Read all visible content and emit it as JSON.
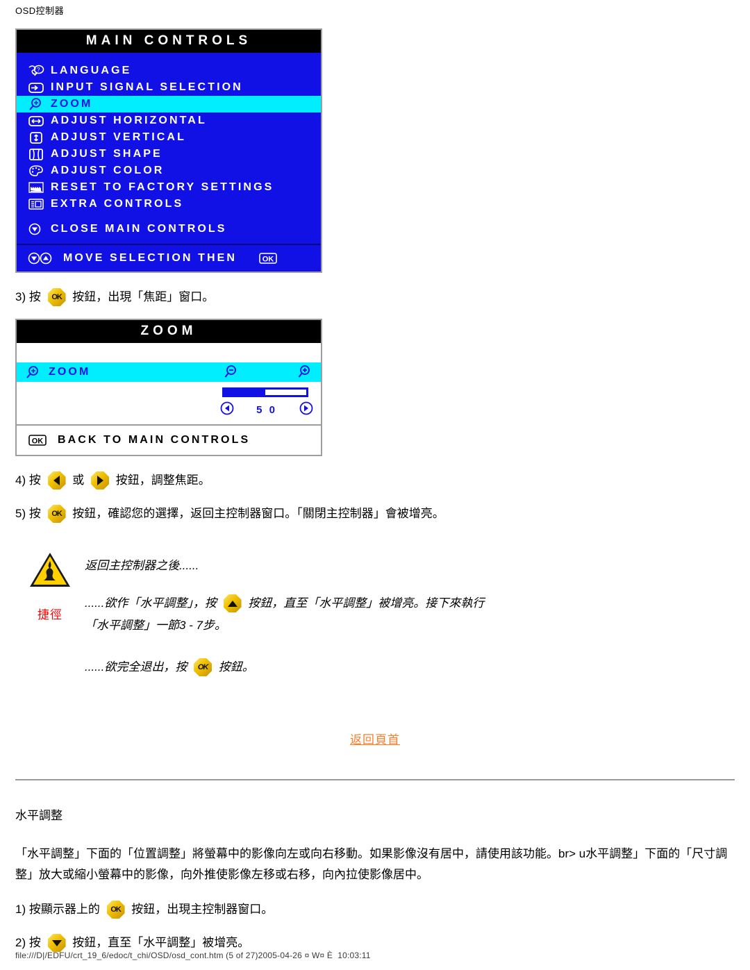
{
  "header": {
    "label": "OSD控制器"
  },
  "main_controls": {
    "title": "MAIN CONTROLS",
    "items": [
      {
        "icon": "language-icon",
        "label": "LANGUAGE",
        "highlighted": false
      },
      {
        "icon": "input-signal-icon",
        "label": "INPUT SIGNAL SELECTION",
        "highlighted": false
      },
      {
        "icon": "zoom-icon",
        "label": "ZOOM",
        "highlighted": true
      },
      {
        "icon": "adjust-horizontal-icon",
        "label": "ADJUST HORIZONTAL",
        "highlighted": false
      },
      {
        "icon": "adjust-vertical-icon",
        "label": "ADJUST VERTICAL",
        "highlighted": false
      },
      {
        "icon": "adjust-shape-icon",
        "label": "ADJUST SHAPE",
        "highlighted": false
      },
      {
        "icon": "adjust-color-icon",
        "label": "ADJUST COLOR",
        "highlighted": false
      },
      {
        "icon": "reset-factory-icon",
        "label": "RESET TO FACTORY SETTINGS",
        "highlighted": false
      },
      {
        "icon": "extra-controls-icon",
        "label": "EXTRA CONTROLS",
        "highlighted": false
      }
    ],
    "close_item": {
      "icon": "down-arrow-icon",
      "label": "CLOSE MAIN CONTROLS"
    },
    "footer": {
      "label": "MOVE SELECTION THEN",
      "ok_icon": "ok-icon"
    }
  },
  "step3": {
    "prefix": "3) 按 ",
    "button": "ok-button",
    "suffix": " 按鈕，出現「焦距」窗口。"
  },
  "zoom_panel": {
    "title": "ZOOM",
    "row_label": "ZOOM",
    "minus_icon": "zoom-out-icon",
    "plus_icon": "zoom-in-icon",
    "value": "5 0",
    "slider_percent": 50,
    "footer_label": "BACK TO MAIN CONTROLS",
    "footer_icon": "ok-icon"
  },
  "step4": {
    "prefix": "4) 按 ",
    "middle": " 或 ",
    "suffix": " 按鈕，調整焦距。"
  },
  "step5": {
    "prefix": "5) 按 ",
    "suffix": " 按鈕，確認您的選擇，返回主控制器窗口。「關閉主控制器」會被增亮。"
  },
  "tip": {
    "word": "捷徑",
    "icon": "warning-triangle-icon",
    "line1": "返回主控制器之後......",
    "line2_a": "......欲作「水平調整」，按 ",
    "line2_b": " 按鈕，直至「水平調整」被增亮。接下來執行",
    "line2_c": "「水平調整」一節3 - 7步。",
    "line3_a": "......欲完全退出，按 ",
    "line3_b": " 按鈕。"
  },
  "back_to_top": {
    "label": "返回頁首"
  },
  "section": {
    "title": "水平調整",
    "paragraph": "「水平調整」下面的「位置調整」將螢幕中的影像向左或向右移動。如果影像沒有居中，請使用該功能。br> u水平調整」下面的「尺寸調整」放大或縮小螢幕中的影像，向外推使影像左移或右移，向內拉使影像居中。",
    "step1_a": "1) 按顯示器上的 ",
    "step1_b": " 按鈕，出現主控制器窗口。",
    "step2_a": "2) 按 ",
    "step2_b": " 按鈕，直至「水平調整」被增亮。"
  },
  "footer": {
    "text": "file:///D|/EDFU/crt_19_6/edoc/t_chi/OSD/osd_cont.htm (5 of 27)2005-04-26 ¤ W¤ È  10:03:11"
  },
  "colors": {
    "osd_blue": "#1111e6",
    "osd_highlight": "#00eeff",
    "osd_title_bg": "#000000",
    "link_orange": "#ff7d29",
    "tip_red": "#ff0000",
    "button_gold": "#efc100"
  }
}
